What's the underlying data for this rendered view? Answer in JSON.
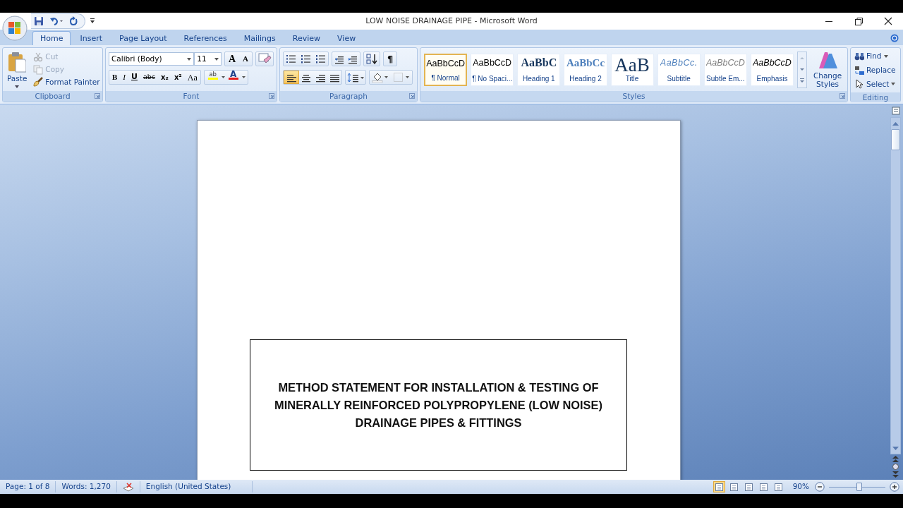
{
  "window": {
    "title": "LOW NOISE DRAINAGE PIPE - Microsoft Word"
  },
  "tabs": [
    {
      "label": "Home",
      "selected": true
    },
    {
      "label": "Insert",
      "selected": false
    },
    {
      "label": "Page Layout",
      "selected": false
    },
    {
      "label": "References",
      "selected": false
    },
    {
      "label": "Mailings",
      "selected": false
    },
    {
      "label": "Review",
      "selected": false
    },
    {
      "label": "View",
      "selected": false
    }
  ],
  "clipboard": {
    "label": "Clipboard",
    "paste": "Paste",
    "items": [
      {
        "label": "Cut",
        "kind": "cut",
        "disabled": true
      },
      {
        "label": "Copy",
        "kind": "copy",
        "disabled": true
      },
      {
        "label": "Format Painter",
        "kind": "painter",
        "disabled": false
      }
    ]
  },
  "font": {
    "label": "Font",
    "name": "Calibri (Body)",
    "size": "11",
    "size_buttons": [
      {
        "text": "A",
        "kind": "grow"
      },
      {
        "text": "A",
        "kind": "shrink"
      }
    ],
    "format_buttons": [
      {
        "text": "B",
        "kind": "bold"
      },
      {
        "text": "I",
        "kind": "italic"
      },
      {
        "text": "U",
        "kind": "underline"
      },
      {
        "text": "abc",
        "kind": "strike"
      },
      {
        "text": "x₂",
        "kind": "sub"
      },
      {
        "text": "x²",
        "kind": "sup"
      },
      {
        "text": "Aa",
        "kind": "case"
      }
    ],
    "color_buttons": [
      {
        "text": "ab",
        "kind": "highlight",
        "color": "#ffff00"
      },
      {
        "text": "A",
        "kind": "fontcolor",
        "color": "#e31b1b"
      }
    ]
  },
  "paragraph": {
    "label": "Paragraph",
    "show_marks": "¶",
    "align_buttons": [
      {
        "kind": "left",
        "selected": true
      },
      {
        "kind": "center",
        "selected": false
      },
      {
        "kind": "right",
        "selected": false
      },
      {
        "kind": "justify",
        "selected": false
      }
    ]
  },
  "styles": {
    "label": "Styles",
    "change": "Change Styles",
    "items": [
      {
        "sample": "AaBbCcD",
        "name": "¶ Normal",
        "kind": "normal",
        "selected": true
      },
      {
        "sample": "AaBbCcD",
        "name": "¶ No Spaci...",
        "kind": "normal",
        "selected": false
      },
      {
        "sample": "AaBbC",
        "name": "Heading 1",
        "kind": "heading1",
        "selected": false
      },
      {
        "sample": "AaBbCc",
        "name": "Heading 2",
        "kind": "heading2",
        "selected": false
      },
      {
        "sample": "AaB",
        "name": "Title",
        "kind": "title",
        "selected": false
      },
      {
        "sample": "AaBbCc.",
        "name": "Subtitle",
        "kind": "subtitle",
        "selected": false
      },
      {
        "sample": "AaBbCcD",
        "name": "Subtle Em...",
        "kind": "subtle",
        "selected": false
      },
      {
        "sample": "AaBbCcD",
        "name": "Emphasis",
        "kind": "emphasis",
        "selected": false
      }
    ]
  },
  "editing": {
    "label": "Editing",
    "items": [
      {
        "label": "Find",
        "kind": "find"
      },
      {
        "label": "Replace",
        "kind": "replace"
      },
      {
        "label": "Select",
        "kind": "select"
      }
    ]
  },
  "document": {
    "title_text": "METHOD STATEMENT FOR INSTALLATION & TESTING OF MINERALLY REINFORCED POLYPROPYLENE (LOW NOISE) DRAINAGE PIPES & FITTINGS"
  },
  "status_bar": {
    "page": "Page: 1 of 8",
    "words": "Words: 1,270",
    "language": "English (United States)",
    "zoom": "90%",
    "zoom_slider": {
      "level": 0.54
    },
    "views": [
      {
        "selected": true
      },
      {
        "selected": false
      },
      {
        "selected": false
      },
      {
        "selected": false
      },
      {
        "selected": false
      }
    ]
  }
}
